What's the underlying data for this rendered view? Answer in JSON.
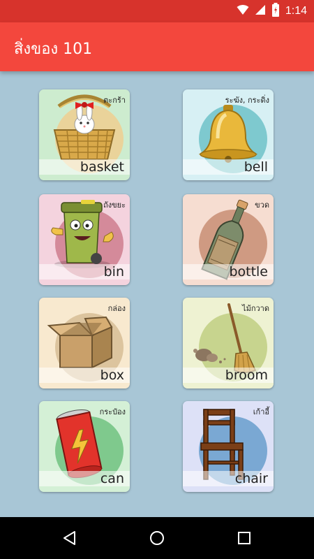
{
  "status": {
    "time": "1:14"
  },
  "app": {
    "title": "สิ่งของ 101"
  },
  "items": [
    {
      "en": "basket",
      "th": "ตะกร้า",
      "bg": "#cdeccf",
      "circle": "#ead39a"
    },
    {
      "en": "bell",
      "th": "ระฆัง, กระดิ่ง",
      "bg": "#d7f0f4",
      "circle": "#7ec9cf"
    },
    {
      "en": "bin",
      "th": "ถังขยะ",
      "bg": "#f4d3de",
      "circle": "#d48a9a"
    },
    {
      "en": "bottle",
      "th": "ขวด",
      "bg": "#f6ddd1",
      "circle": "#cf9a82"
    },
    {
      "en": "box",
      "th": "กล่อง",
      "bg": "#f8e9cf",
      "circle": "#dcc49e"
    },
    {
      "en": "broom",
      "th": "ไม้กวาด",
      "bg": "#eef2d2",
      "circle": "#c7d48e"
    },
    {
      "en": "can",
      "th": "กระป๋อง",
      "bg": "#d4f0d6",
      "circle": "#7fc98d"
    },
    {
      "en": "chair",
      "th": "เก้าอี้",
      "bg": "#dde1f7",
      "circle": "#7aa8d3"
    }
  ],
  "icons": {
    "wifi": "wifi-icon",
    "signal": "signal-icon",
    "battery": "battery-icon",
    "back": "back-icon",
    "home": "home-icon",
    "recents": "recents-icon"
  }
}
